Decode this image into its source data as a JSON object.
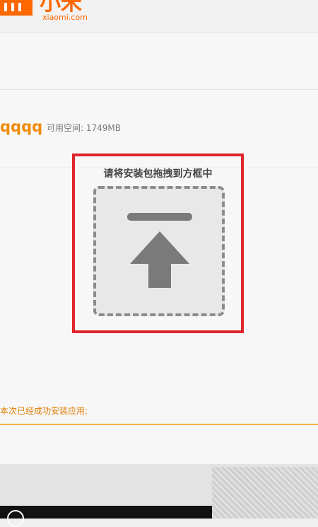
{
  "header": {
    "logo_text": "小米",
    "logo_domain": "xiaomi.com"
  },
  "device": {
    "name": "qqqq",
    "space_label": "可用空间: 1749MB"
  },
  "drop_zone": {
    "title": "请将安装包拖拽到方框中",
    "icon": "upload-icon"
  },
  "status": {
    "message": "本次已经成功安装应用;"
  },
  "colors": {
    "brand": "#ff6700",
    "device_name": "#f08a00",
    "highlight_border": "#e0262a",
    "status_text": "#e07d00",
    "status_line": "#f5b24a"
  }
}
